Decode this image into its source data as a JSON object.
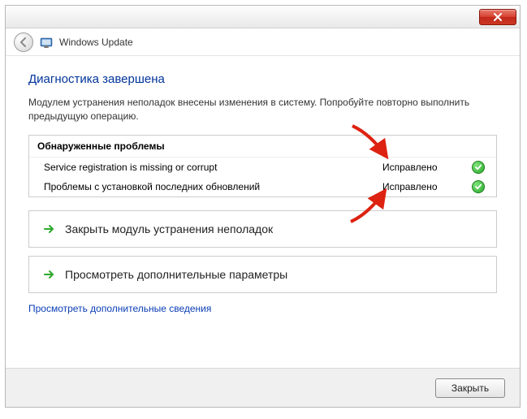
{
  "window": {
    "title": "Windows Update"
  },
  "main": {
    "heading": "Диагностика завершена",
    "description": "Модулем устранения неполадок внесены изменения в систему. Попробуйте повторно выполнить предыдущую операцию.",
    "problems_header": "Обнаруженные проблемы",
    "problems": [
      {
        "name": "Service registration is missing or corrupt",
        "status": "Исправлено"
      },
      {
        "name": "Проблемы с установкой последних обновлений",
        "status": "Исправлено"
      }
    ],
    "actions": {
      "close_troubleshooter": "Закрыть модуль устранения неполадок",
      "view_advanced": "Просмотреть дополнительные параметры"
    },
    "details_link": "Просмотреть дополнительные сведения"
  },
  "footer": {
    "close_label": "Закрыть"
  }
}
